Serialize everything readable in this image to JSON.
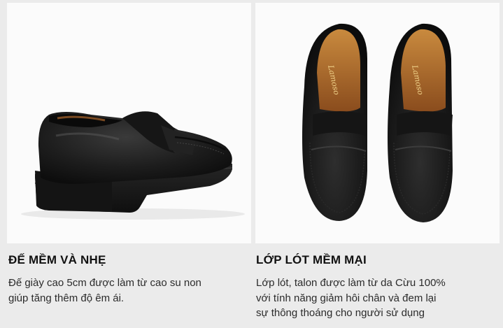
{
  "features": [
    {
      "title": "ĐẾ MỀM VÀ NHẸ",
      "lines": [
        "Đế giày cao 5cm được làm từ cao su non",
        "giúp tăng thêm độ êm ái."
      ]
    },
    {
      "title": "LỚP LÓT MỀM MẠI",
      "lines": [
        "Lớp lót, talon được làm từ da Cừu 100%",
        "với tính năng giảm hôi chân và đem lại",
        "sự thông thoáng cho người sử dụng"
      ]
    }
  ],
  "brand_logo_text": "Lamoso",
  "colors": {
    "background": "#ebebeb",
    "photo_bg": "#fbfbfb",
    "leather": "#1b1b1b",
    "lining": "#a8642a"
  }
}
